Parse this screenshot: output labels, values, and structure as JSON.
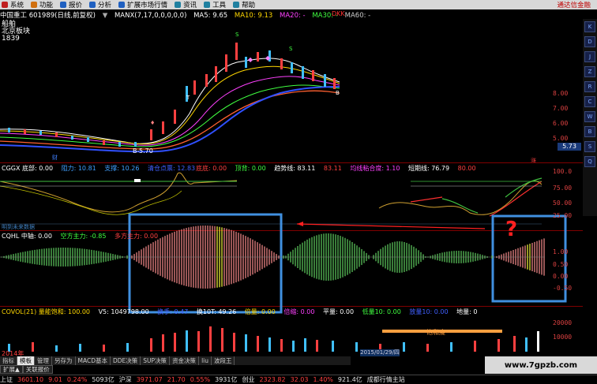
{
  "menu": {
    "items": [
      {
        "label": "系统",
        "color": "#c02020"
      },
      {
        "label": "功能",
        "color": "#d07010"
      },
      {
        "label": "报价",
        "color": "#2060c0"
      },
      {
        "label": "分析",
        "color": "#2060c0"
      },
      {
        "label": "扩展市场行情",
        "color": "#2060c0"
      },
      {
        "label": "资讯",
        "color": "#2080a0"
      },
      {
        "label": "工具",
        "color": "#2080a0"
      },
      {
        "label": "帮助",
        "color": "#2080a0"
      }
    ],
    "broker": "通达信金融"
  },
  "header": {
    "stock": "中国重工 601989(日线,前复权)",
    "manx": "MANX(7,17,0,0,0,0,0)",
    "ma5": "MA5: 9.65",
    "ma10": "MA10: 9.13",
    "ma20": "MA20: -",
    "ma30": "MA30: -",
    "ma60": "MA60: -",
    "tag": "DKK"
  },
  "stock_block": {
    "line1": "船舶",
    "line2": "北京板块",
    "line3": "1839"
  },
  "price_axis": [
    "8.00",
    "7.00",
    "6.00",
    "5.00"
  ],
  "price_tag": "5.73",
  "low_label": "5.70",
  "cggx": {
    "title": "CGGX 底部: 0.00",
    "pressure": "阻力: 10.81",
    "support": "支撑: 10.26",
    "buy_point": "清仓点票: 12.83",
    "low": "底底: 0.00",
    "top": "顶背: 0.00",
    "trend": "趋势线: 83.11",
    "trend2": "83.11",
    "mid": "均线粘合度: 1.10",
    "short": "短期线: 76.79",
    "short2": "80.00",
    "axis": [
      "100.0",
      "75.00",
      "50.00",
      "25.00"
    ],
    "future_label": "明到未来数据"
  },
  "cqhl": {
    "title": "CQHL 中轴: 0.00",
    "air": "空方主力: -0.85",
    "multi": "多方主力: 0.00",
    "axis": [
      "1.00",
      "0.50",
      "0.00",
      "-0.50"
    ],
    "question_mark": "?"
  },
  "covol": {
    "title": "COVOL(21) 量能饱和: 100.00",
    "v5": "V5: 1049798.00",
    "vmid": "换手: 0.47",
    "turn": "换10T: 49.26",
    "mult": "倍量: 0.00",
    "mult2": "倍缩: 0.00",
    "flat": "平量: 0.00",
    "big": "低量10: 0.00",
    "amt": "放量10: 0.00",
    "land": "地量: 0",
    "axis": [
      "20000",
      "10000"
    ],
    "saturation_label": "饱和度"
  },
  "date_box": "2015/01/29/四",
  "year_label": "2014年",
  "tabs": [
    "指标",
    "模板",
    "管理",
    "另存为",
    "MACD基本",
    "DDE决策",
    "SUP决策",
    "资金决策",
    "liu",
    "波段王"
  ],
  "active_tab": 1,
  "subtabs": [
    "扩展▲",
    "关联报价"
  ],
  "status": [
    {
      "text": "上证",
      "color": "#e0e0e0"
    },
    {
      "text": "3601.10",
      "color": "#ff4040"
    },
    {
      "text": "9.01",
      "color": "#ff4040"
    },
    {
      "text": "0.24%",
      "color": "#ff4040"
    },
    {
      "text": "5093亿",
      "color": "#e0e0e0"
    },
    {
      "text": "沪深",
      "color": "#e0e0e0"
    },
    {
      "text": "3971.07",
      "color": "#ff4040"
    },
    {
      "text": "21.70",
      "color": "#ff4040"
    },
    {
      "text": "0.55%",
      "color": "#ff4040"
    },
    {
      "text": "3931亿",
      "color": "#e0e0e0"
    },
    {
      "text": "创业",
      "color": "#e0e0e0"
    },
    {
      "text": "2323.82",
      "color": "#ff4040"
    },
    {
      "text": "32.03",
      "color": "#ff4040"
    },
    {
      "text": "1.40%",
      "color": "#ff4040"
    },
    {
      "text": "921.4亿",
      "color": "#e0e0e0"
    },
    {
      "text": "成都行情主站",
      "color": "#e0e0e0"
    }
  ],
  "watermark": "www.7gpzb.com",
  "toolbar": [
    "K",
    "D",
    "J",
    "Z",
    "R",
    "C",
    "W",
    "B",
    "S",
    "Q"
  ]
}
